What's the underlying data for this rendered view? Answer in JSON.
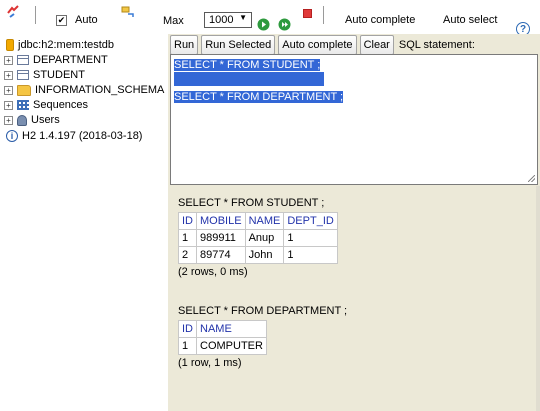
{
  "toolbar": {
    "auto_commit_label": "Auto",
    "auto_commit_checked": true,
    "max_label": "Max",
    "max_rows_value": "1000",
    "auto_complete_label": "Auto complete",
    "auto_select_label": "Auto select",
    "help_glyph": "?",
    "icons": [
      "refresh-icon",
      "rollback-icon",
      "run-icon",
      "run-selected-icon",
      "stop-icon",
      "help-icon"
    ]
  },
  "tree": {
    "connection": "jdbc:h2:mem:testdb",
    "items": [
      {
        "label": "DEPARTMENT",
        "icon": "table-icon"
      },
      {
        "label": "STUDENT",
        "icon": "table-icon"
      },
      {
        "label": "INFORMATION_SCHEMA",
        "icon": "folder-icon"
      },
      {
        "label": "Sequences",
        "icon": "sequences-icon"
      },
      {
        "label": "Users",
        "icon": "users-icon"
      }
    ],
    "version": "H2 1.4.197 (2018-03-18)"
  },
  "buttons": {
    "run": "Run",
    "run_selected": "Run Selected",
    "auto_complete": "Auto complete",
    "clear": "Clear",
    "sql_statement_label": "SQL statement:"
  },
  "editor": {
    "line1": "SELECT * FROM STUDENT ;",
    "line2": "",
    "line3": "SELECT * FROM  DEPARTMENT ;"
  },
  "results": [
    {
      "sql": "SELECT * FROM STUDENT ;",
      "columns": [
        "ID",
        "MOBILE",
        "NAME",
        "DEPT_ID"
      ],
      "rows": [
        [
          "1",
          "989911",
          "Anup",
          "1"
        ],
        [
          "2",
          "89774",
          "John",
          "1"
        ]
      ],
      "summary": "(2 rows, 0 ms)"
    },
    {
      "sql": "SELECT * FROM  DEPARTMENT ;",
      "columns": [
        "ID",
        "NAME"
      ],
      "rows": [
        [
          "1",
          "COMPUTER"
        ]
      ],
      "summary": "(1 row, 1 ms)"
    }
  ],
  "colors": {
    "panel_bg": "#ece9d8",
    "header_text": "#2233aa",
    "selection": "#3367d6"
  }
}
